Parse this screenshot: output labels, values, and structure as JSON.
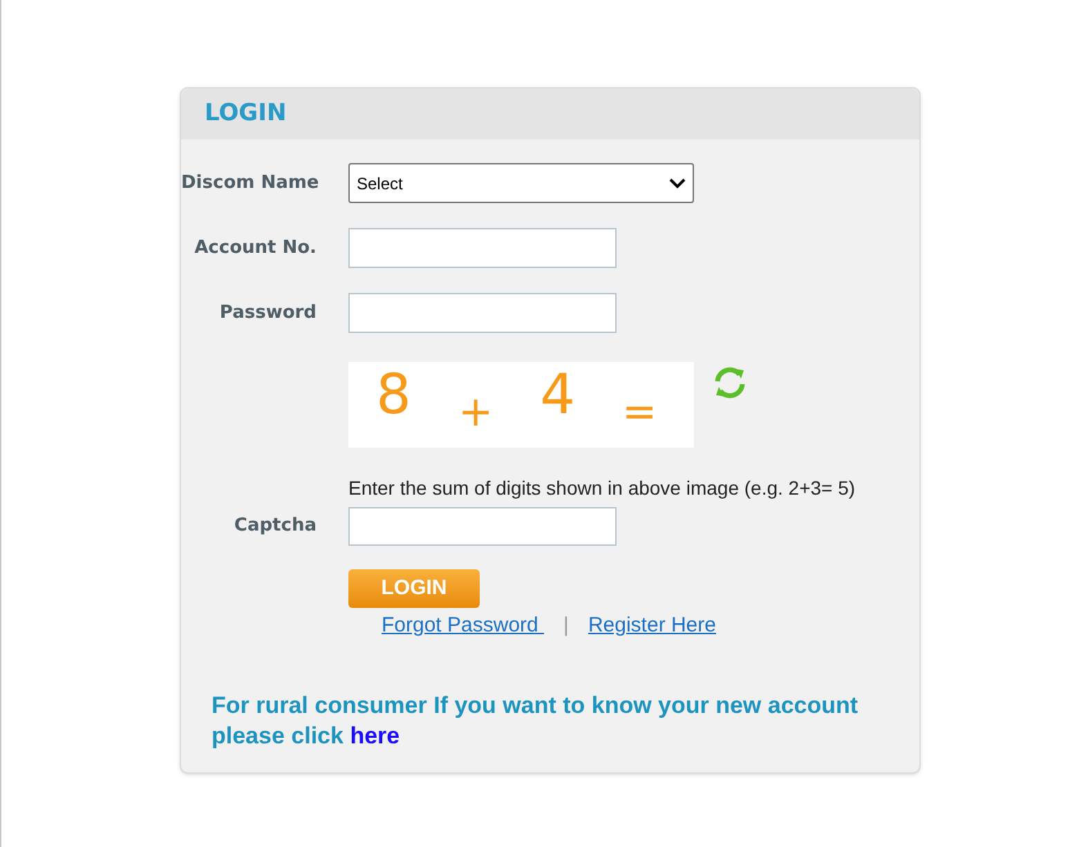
{
  "panel": {
    "title": "LOGIN"
  },
  "fields": [
    {
      "kind": "select",
      "label": "Discom Name",
      "value": "Select"
    },
    {
      "kind": "text",
      "label": "Account No."
    },
    {
      "kind": "password",
      "label": "Password"
    }
  ],
  "captcha": {
    "label": "Captcha",
    "image_tokens": [
      "8",
      "+",
      "4",
      "="
    ],
    "hint": "Enter the sum of digits shown in above image (e.g. 2+3= 5)"
  },
  "login_button": "LOGIN",
  "links": [
    {
      "label": "Forgot Password "
    },
    {
      "label": "Register Here"
    }
  ],
  "separator": "|",
  "rural_note": {
    "text": "For rural consumer If you want to know your new account please click",
    "link": "here"
  }
}
